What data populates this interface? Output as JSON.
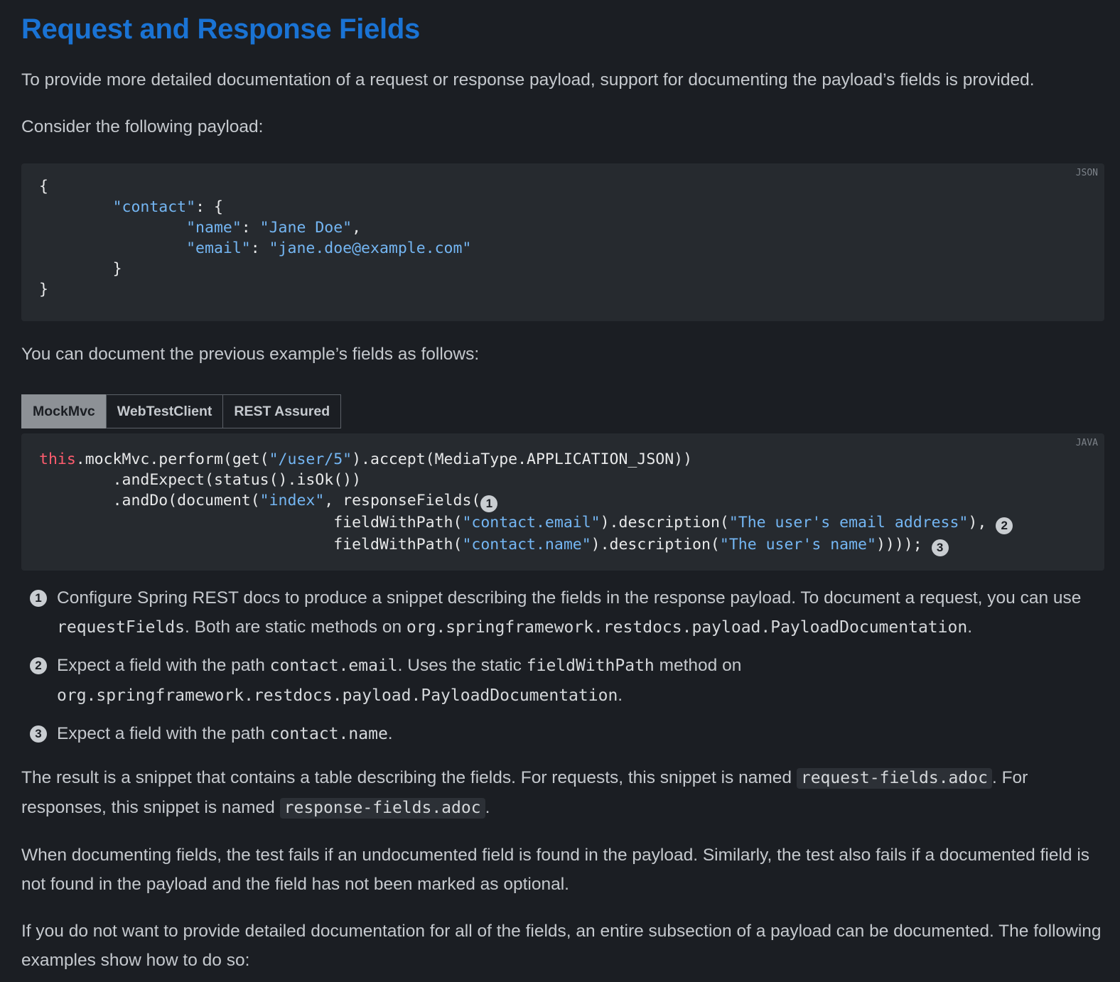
{
  "heading": "Request and Response Fields",
  "intro": "To provide more detailed documentation of a request or response payload, support for documenting the payload’s fields is provided.",
  "consider": "Consider the following payload:",
  "json_block": {
    "lang": "JSON",
    "lines": [
      {
        "t": "{"
      },
      {
        "pre": "\t",
        "key": "\"contact\"",
        "post": ": {"
      },
      {
        "pre": "\t\t",
        "key": "\"name\"",
        "mid": ": ",
        "val": "\"Jane Doe\"",
        "post": ","
      },
      {
        "pre": "\t\t",
        "key": "\"email\"",
        "mid": ": ",
        "val": "\"jane.doe@example.com\""
      },
      {
        "pre": "\t",
        "t": "}"
      },
      {
        "t": "}"
      }
    ]
  },
  "document_as": "You can document the previous example’s fields as follows:",
  "tabs": [
    "MockMvc",
    "WebTestClient",
    "REST Assured"
  ],
  "active_tab": 0,
  "java_block": {
    "lang": "JAVA",
    "line1": {
      "kw": "this",
      "a": ".mockMvc.perform(get(",
      "s": "\"/user/5\"",
      "b": ").accept(MediaType.APPLICATION_JSON))"
    },
    "line2": "\t.andExpect(status().isOk())",
    "line3": {
      "a": "\t.andDo(document(",
      "s": "\"index\"",
      "b": ", responseFields("
    },
    "line4": {
      "a": "\t\t\t\tfieldWithPath(",
      "s1": "\"contact.email\"",
      "b": ").description(",
      "s2": "\"The user's email address\"",
      "c": "), "
    },
    "line5": {
      "a": "\t\t\t\tfieldWithPath(",
      "s1": "\"contact.name\"",
      "b": ").description(",
      "s2": "\"The user's name\"",
      "c": ")))); "
    },
    "callouts": [
      "1",
      "2",
      "3"
    ]
  },
  "callout_list": [
    {
      "num": "1",
      "t1": "Configure Spring REST docs to produce a snippet describing the fields in the response payload. To document a request, you can use ",
      "c1": "requestFields",
      "t2": ". Both are static methods on ",
      "c2": "org.springframework.restdocs.payload.PayloadDocumentation",
      "t3": "."
    },
    {
      "num": "2",
      "t1": "Expect a field with the path ",
      "c1": "contact.email",
      "t2": ". Uses the static ",
      "c2": "fieldWithPath",
      "t3": " method on ",
      "c3": "org.springframework.restdocs.payload.PayloadDocumentation",
      "t4": "."
    },
    {
      "num": "3",
      "t1": "Expect a field with the path ",
      "c1": "contact.name",
      "t2": "."
    }
  ],
  "result_para": {
    "t1": "The result is a snippet that contains a table describing the fields. For requests, this snippet is named ",
    "c1": "request-fields.adoc",
    "t2": ". For responses, this snippet is named ",
    "c2": "response-fields.adoc",
    "t3": "."
  },
  "undocumented_para": "When documenting fields, the test fails if an undocumented field is found in the payload. Similarly, the test also fails if a documented field is not found in the payload and the field has not been marked as optional.",
  "subsection_para": "If you do not want to provide detailed documentation for all of the fields, an entire subsection of a payload can be documented. The following examples show how to do so:"
}
